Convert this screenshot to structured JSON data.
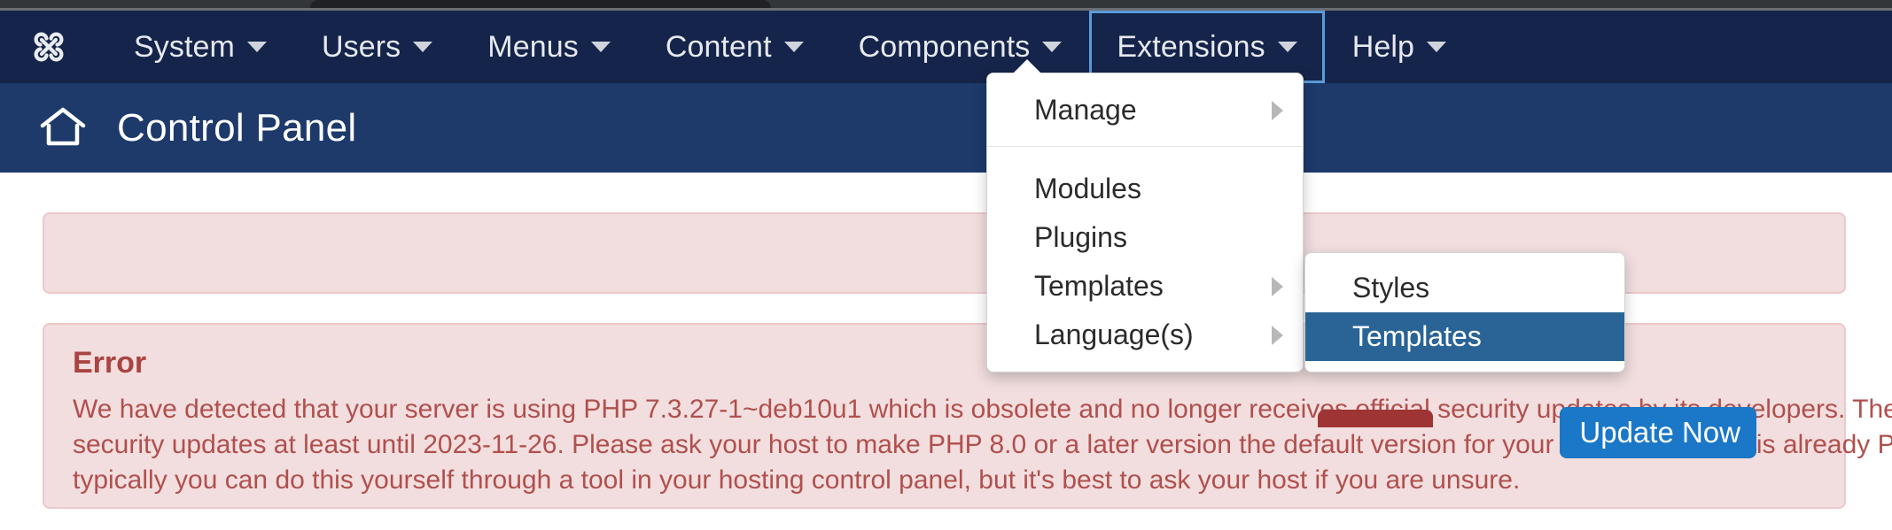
{
  "browser": {
    "tab_strip": "chrome-tab-strip"
  },
  "colors": {
    "nav_bg": "#15244a",
    "header_bg": "#1e3a6b",
    "focus_outline": "#5a9bd8",
    "alert_bg": "#f2dede",
    "alert_border": "#ecc8cc",
    "error_heading": "#a94442",
    "error_text": "#b0504e",
    "primary_button": "#1b77c7",
    "danger_button": "#9e3434",
    "menu_active": "#2a6496"
  },
  "topnav": {
    "logo": "joomla-logo",
    "items": [
      {
        "label": "System",
        "has_caret": true,
        "focused": false
      },
      {
        "label": "Users",
        "has_caret": true,
        "focused": false
      },
      {
        "label": "Menus",
        "has_caret": true,
        "focused": false
      },
      {
        "label": "Content",
        "has_caret": true,
        "focused": false
      },
      {
        "label": "Components",
        "has_caret": true,
        "focused": false
      },
      {
        "label": "Extensions",
        "has_caret": true,
        "focused": true
      },
      {
        "label": "Help",
        "has_caret": true,
        "focused": false
      }
    ]
  },
  "page_header": {
    "icon": "home-icon",
    "title": "Control Panel"
  },
  "extensions_menu": {
    "items": [
      {
        "label": "Manage",
        "has_submenu": true,
        "active": false
      },
      {
        "label": "Modules",
        "has_submenu": false,
        "active": false
      },
      {
        "label": "Plugins",
        "has_submenu": false,
        "active": false
      },
      {
        "label": "Templates",
        "has_submenu": true,
        "active": false
      },
      {
        "label": "Language(s)",
        "has_submenu": true,
        "active": false
      }
    ]
  },
  "templates_submenu": {
    "items": [
      {
        "label": "Styles",
        "active": false
      },
      {
        "label": "Templates",
        "active": true
      }
    ]
  },
  "update_alert": {
    "update_button_label": "Update Now",
    "danger_button_label": ""
  },
  "error_alert": {
    "heading": "Error",
    "body": "We have detected that your server is using PHP 7.3.27-1~deb10u1 which is obsolete and no longer receives official security updates by its developers. The Joo\nsecurity updates at least until 2023-11-26. Please ask your host to make PHP 8.0 or a later version the default version for your site. If your host is already PHP\ntypically you can do this yourself through a tool in your hosting control panel, but it's best to ask your host if you are unsure."
  }
}
